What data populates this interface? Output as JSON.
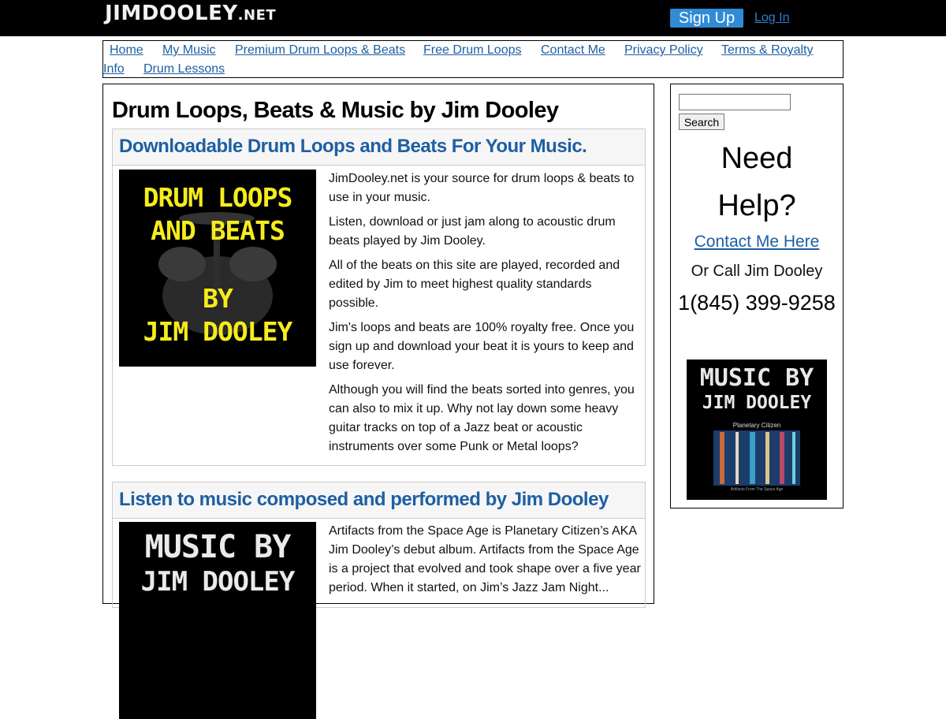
{
  "site": {
    "logo_main": "JimDooley",
    "logo_tld": ".net",
    "signup_label": "Sign Up",
    "login_label": "Log In"
  },
  "nav": {
    "items": [
      "Home",
      "My Music",
      "Premium Drum Loops & Beats",
      "Free Drum Loops",
      "Contact Me",
      "Privacy Policy",
      "Terms & Royalty",
      "Info",
      "Drum Lessons"
    ]
  },
  "main": {
    "page_title": "Drum Loops, Beats & Music by Jim Dooley",
    "sections": [
      {
        "title": "Downloadable Drum Loops and Beats For Your Music.",
        "image_lines": [
          "DRUM LOOPS",
          "AND BEATS",
          "BY",
          "JIM DOOLEY"
        ],
        "paragraphs": [
          "JimDooley.net is your source for drum loops & beats to use in your music.",
          "Listen, download or just jam along to acoustic drum beats played by Jim Dooley.",
          "All of the beats on this site are played, recorded and edited by Jim to meet highest quality standards possible.",
          "Jim's loops and beats are 100% royalty free. Once you sign up and download your beat it is yours to keep and use forever.",
          "Although you will find the beats sorted into genres, you can also to mix it up. Why not lay down some heavy guitar tracks on top of a Jazz beat or acoustic instruments over some Punk or Metal loops?"
        ]
      },
      {
        "title": "Listen to music composed and performed by Jim Dooley",
        "image_lines": [
          "MUSIC BY",
          "JIM DOOLEY"
        ],
        "paragraphs": [
          "Artifacts from the Space Age is Planetary Citizen’s AKA Jim Dooley’s debut album. Artifacts from the Space Age is a project that evolved and took shape over a five year period. When it started, on Jim’s Jazz Jam Night..."
        ]
      }
    ]
  },
  "sidebar": {
    "search_placeholder": "",
    "search_button": "Search",
    "need_help_line1": "Need",
    "need_help_line2": "Help?",
    "contact_link": "Contact Me Here",
    "call_line": "Or Call Jim Dooley",
    "phone": "1(845) 399-9258",
    "album_line1": "MUSIC BY",
    "album_line2": "JIM DOOLEY",
    "album_subtitle": "Planetary Citizen",
    "album_footer": "Artifacts From The Space Age"
  },
  "colors": {
    "topbar": "#000000",
    "signup_bg": "#2f8bd6",
    "link": "#1d5fa3",
    "art_yellow": "#f5ec1c"
  }
}
